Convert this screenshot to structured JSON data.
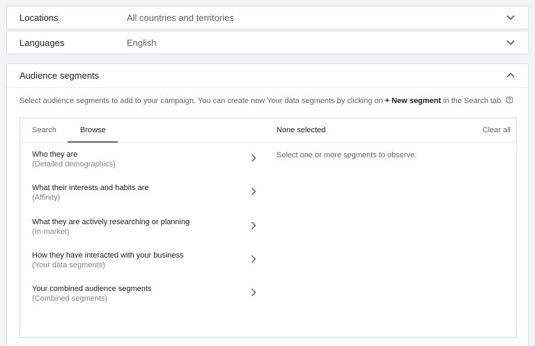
{
  "locations": {
    "label": "Locations",
    "value": "All countries and territories",
    "icon": "chevron-down-icon"
  },
  "languages": {
    "label": "Languages",
    "value": "English",
    "icon": "chevron-down-icon"
  },
  "audience": {
    "title": "Audience segments",
    "icon": "chevron-up-icon",
    "description_prefix": "Select audience segments to add to your campaign. You can create new Your data segments by clicking on ",
    "description_bold": "+ New segment",
    "description_suffix": " in the Search tab.",
    "help_icon": "help-circle-icon",
    "tabs": [
      {
        "label": "Search",
        "active": false
      },
      {
        "label": "Browse",
        "active": true
      }
    ],
    "items": [
      {
        "title": "Who they are",
        "subtitle": "(Detailed demographics)"
      },
      {
        "title": "What their interests and habits are",
        "subtitle": "(Affinity)"
      },
      {
        "title": "What they are actively researching or planning",
        "subtitle": "(In-market)"
      },
      {
        "title": "How they have interacted with your business",
        "subtitle": "(Your data segments)"
      },
      {
        "title": "Your combined audience segments",
        "subtitle": "(Combined segments)"
      }
    ],
    "selected_header": "None selected",
    "clear_all": "Clear all",
    "empty_message": "Select one or more segments to observe."
  },
  "colors": {
    "background": "#f1f3f4",
    "card": "#ffffff",
    "border": "#dadce0",
    "text_primary": "#202124",
    "text_secondary": "#5f6368"
  }
}
